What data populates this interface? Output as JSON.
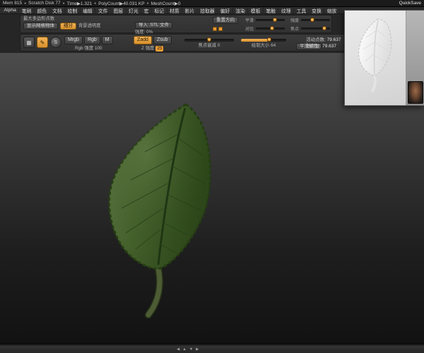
{
  "status_bar": {
    "separator": "●",
    "segments": [
      "Mem 815",
      "Scratch Disk 77",
      "Time▶1.321",
      "PolyCount▶40.031 KP",
      "MeshCount▶0"
    ],
    "quicksave": "QuickSave"
  },
  "menu_bar": {
    "items": [
      "Alpha",
      "笔刷",
      "颜色",
      "文档",
      "绘制",
      "编辑",
      "文件",
      "图层",
      "灯光",
      "宏",
      "标记",
      "材质",
      "影片",
      "拾取器",
      "偏好",
      "渲染",
      "模板",
      "笔触",
      "纹理",
      "工具",
      "变换",
      "缩放"
    ]
  },
  "options_shelf": {
    "max_poly_label": "最大多边形点数",
    "show_mesh_toggle": "显示网格物体",
    "background_label": "背景透明度",
    "subdivide_button": "细分",
    "import_button": "导入 .STL 文件",
    "strength_label": "强度: 0%",
    "reset_button": "重置方向",
    "sliders": [
      {
        "label": "平滑"
      },
      {
        "label": "强度"
      },
      {
        "label": "对比"
      },
      {
        "label": "焦点"
      }
    ]
  },
  "draw_shelf": {
    "mode_buttons": [
      "Mrgb",
      "Rgb",
      "M"
    ],
    "rgb_intensity_label": "Rgb 强度",
    "rgb_intensity_value": "100",
    "zadd_button": "Zadd",
    "zsub_button": "Zsub",
    "z_intensity_label": "Z 强度",
    "z_intensity_value": "25",
    "focal_label": "焦点衰减",
    "focal_value": "0",
    "draw_size_label": "绘制大小",
    "draw_size_value": "64",
    "shaded_button": "平滑着色",
    "counts": {
      "active_label": "活动点数:",
      "active_value": "79.637",
      "total_label": "总点数:",
      "total_value": "79.637"
    }
  },
  "icons": {
    "grid_glyph": "▦",
    "brush_glyph": "✎",
    "material_glyph": "S"
  },
  "bottom_bar": {
    "controls": [
      "◀",
      "▲",
      "▼",
      "▶"
    ]
  },
  "colors": {
    "accent": "#e89b35",
    "leaf_light": "#5a7440",
    "leaf_dark": "#2f4a1e",
    "canvas_top": "#4c4c4c",
    "canvas_bottom": "#121212"
  }
}
